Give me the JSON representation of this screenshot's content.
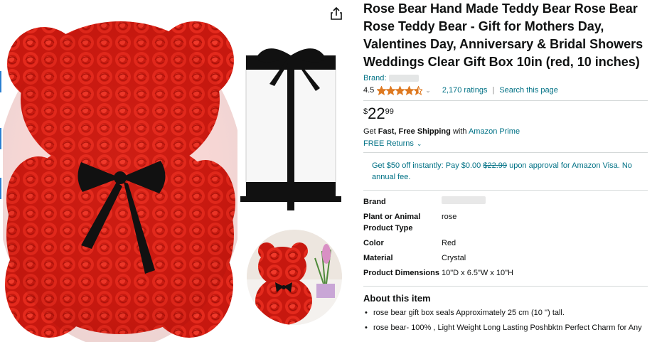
{
  "product": {
    "title": "Rose Bear Hand Made Teddy Bear Rose Bear Rose Teddy Bear - Gift for Mothers Day, Valentines Day, Anniversary & Bridal Showers Weddings Clear Gift Box 10in (red, 10 inches)",
    "brand_label": "Brand:",
    "rating_value": "4.5",
    "rating_stars": 4.5,
    "ratings_count": "2,170 ratings",
    "search_link": "Search this page",
    "price_symbol": "$",
    "price_whole": "22",
    "price_fraction": "99"
  },
  "shipping": {
    "prefix": "Get",
    "bold": "Fast, Free Shipping",
    "mid": "with",
    "prime": "Amazon Prime",
    "returns": "FREE Returns"
  },
  "offer": {
    "text_before": "Get $50 off instantly: Pay $0.00",
    "strike_price": "$22.99",
    "text_after": "upon approval for Amazon Visa. No annual fee."
  },
  "specs": [
    {
      "key": "Brand",
      "value": ""
    },
    {
      "key": "Plant or Animal Product Type",
      "value": "rose"
    },
    {
      "key": "Color",
      "value": "Red"
    },
    {
      "key": "Material",
      "value": "Crystal"
    },
    {
      "key": "Product Dimensions",
      "value": "10\"D x 6.5\"W x 10\"H"
    }
  ],
  "about": {
    "heading": "About this item",
    "bullets": [
      "rose bear gift box seals Approximately 25 cm (10 '') tall.",
      "rose bear- 100% , Light Weight Long Lasting Poshbktn Perfect Charm for Any"
    ]
  },
  "icons": {
    "share": "share-icon",
    "star": "star-icon",
    "chevron": "chevron-down-icon"
  },
  "colors": {
    "link": "#007185",
    "star": "#de7921",
    "rose": "#d61f14",
    "ribbon": "#111111"
  }
}
